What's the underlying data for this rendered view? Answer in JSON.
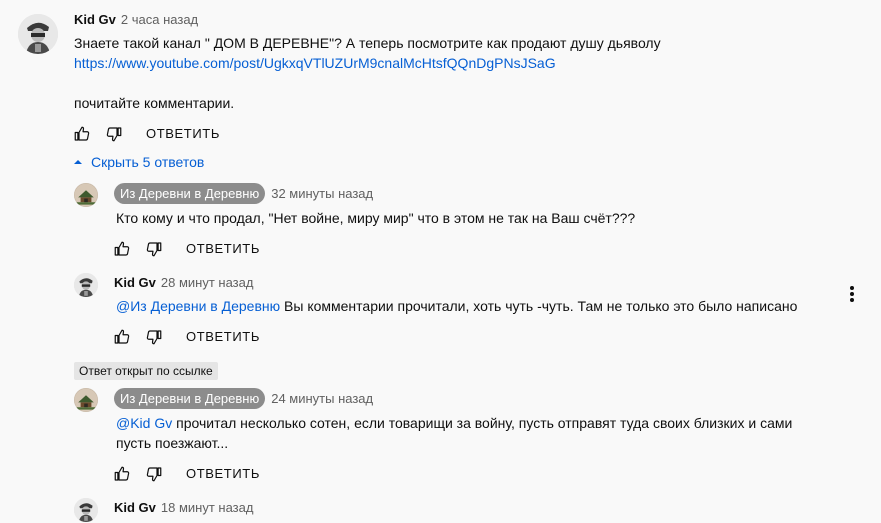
{
  "comments": {
    "top": {
      "author": "Kid Gv",
      "time": "2 часа назад",
      "line1": "Знаете такой канал \" ДОМ В ДЕРЕВНЕ\"? А теперь посмотрите как продают душу дьяволу",
      "link": "https://www.youtube.com/post/UgkxqVTlUZUrM9cnalMcHtsfQQnDgPNsJSaG",
      "line2": "почитайте комментарии.",
      "reply_label": "ОТВЕТИТЬ"
    },
    "toggle_replies_label": "Скрыть 5 ответов",
    "replies": [
      {
        "author": "Из Деревни в Деревню",
        "time": "32 минуты назад",
        "text": "Кто кому и что продал, \"Нет войне, миру мир\" что в этом не так на Ваш счёт???",
        "reply_label": "ОТВЕТИТЬ"
      },
      {
        "author": "Kid Gv",
        "time": "28 минут назад",
        "mention": "@Из Деревни в Деревню",
        "text": "Вы комментарии прочитали, хоть чуть -чуть. Там не только это было написано",
        "reply_label": "ОТВЕТИТЬ"
      },
      {
        "badge": "Ответ открыт по ссылке",
        "author": "Из Деревни в Деревню",
        "time": "24 минуты назад",
        "mention": "@Kid Gv",
        "text_line1": "прочитал несколько сотен, если товарищи за войну, пусть отправят туда своих близких и сами",
        "text_line2": "пусть поезжают...",
        "reply_label": "ОТВЕТИТЬ"
      },
      {
        "author": "Kid Gv",
        "time": "18 минут назад"
      }
    ]
  },
  "icons": {
    "like": "thumbs-up-icon",
    "dislike": "thumbs-down-icon",
    "expand": "chevron-up-icon",
    "menu": "more-vertical-icon"
  },
  "colors": {
    "link": "#065fd4",
    "badge_bg": "#8c8c8c",
    "chip_bg": "#e5e5e5"
  }
}
